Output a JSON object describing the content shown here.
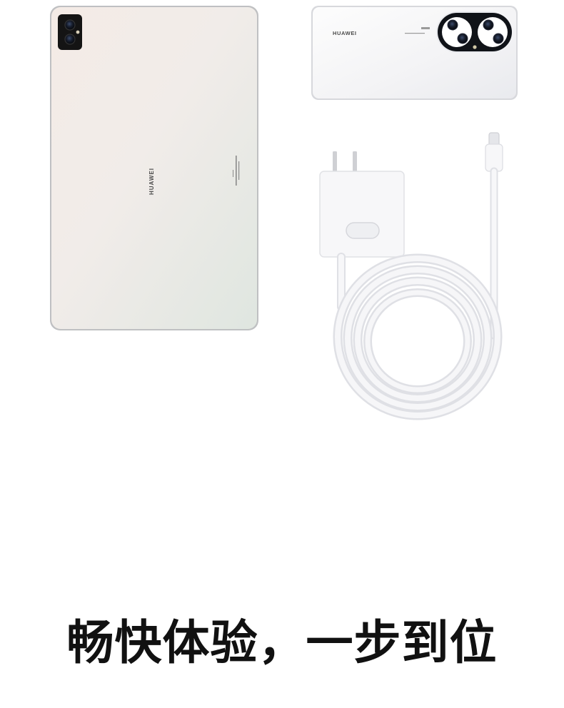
{
  "tablet": {
    "brand_text": "HUAWEI",
    "color_tablet_body": "#f2ece8",
    "color_tablet_frame": "#c9c9cb"
  },
  "phone": {
    "brand_text": "HUAWEI",
    "color_phone_body": "#f7f7f8",
    "color_camera_ring": "#111418"
  },
  "headline": {
    "text": "畅快体验，一步到位",
    "color": "#111111"
  }
}
